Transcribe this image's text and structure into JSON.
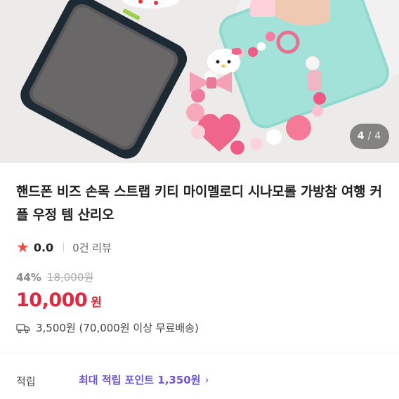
{
  "gallery": {
    "current": "4",
    "separator": "/",
    "total": "4"
  },
  "product": {
    "title": "핸드폰 비즈 손목 스트랩 키티 마이멜로디 시나모롤 가방참 여행 커플 우정 템 산리오",
    "rating": "0.0",
    "review_count": "0건 리뷰",
    "discount_percent": "44%",
    "original_price": "18,000원",
    "price": "10,000",
    "price_unit": "원",
    "shipping": "3,500원 (70,000원 이상 무료배송)"
  },
  "points": {
    "label": "적립",
    "text": "최대 적립 포인트 1,350원",
    "chevron": "›"
  },
  "colors": {
    "accent_red": "#e1283f",
    "star": "#f4493f",
    "points_purple": "#6d57d6"
  },
  "icons": {
    "rating": "star-icon",
    "shipping": "truck-icon",
    "points_more": "chevron-right-icon"
  }
}
